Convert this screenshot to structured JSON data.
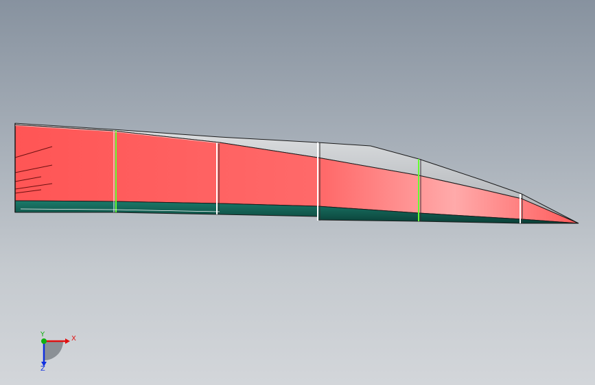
{
  "viewport": {
    "background_top": "#87929f",
    "background_bottom": "#d3d6da"
  },
  "model": {
    "colors": {
      "face": "#ff5a5a",
      "face_light": "#ffa8a8",
      "top_surface": "#b9bcbf",
      "bottom_flange": "#0f5b50",
      "edge": "#1a1a1a",
      "rib_highlight": "#66ff33"
    }
  },
  "triad": {
    "x_label": "X",
    "y_label": "Y",
    "z_label": "Z",
    "x_color": "#e01010",
    "y_color": "#10b010",
    "z_color": "#1030e0"
  }
}
